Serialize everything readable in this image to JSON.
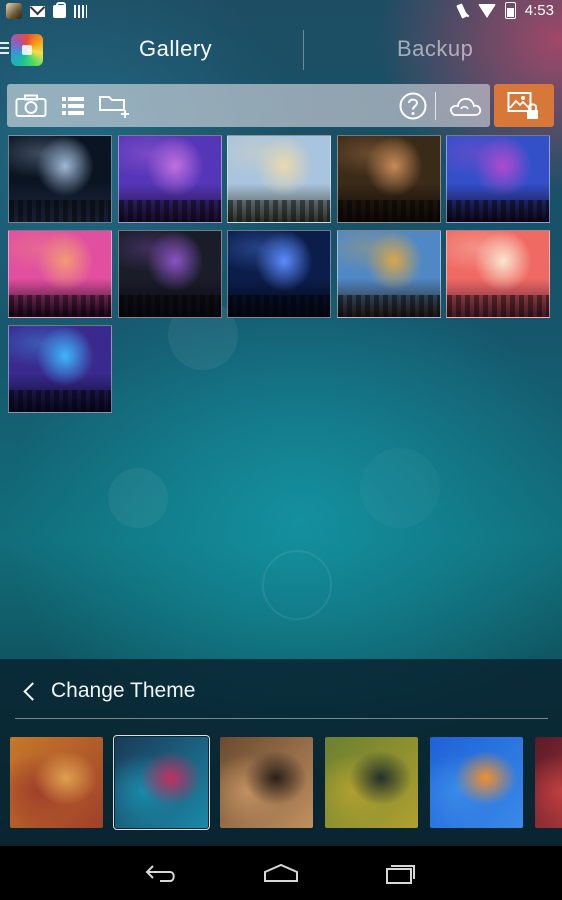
{
  "status_bar": {
    "time": "4:53",
    "left_icons": [
      "app-thumbnail-icon",
      "mail-icon",
      "shopping-bag-icon",
      "barcode-icon"
    ],
    "right_icons": [
      "vibrate-off-icon",
      "wifi-icon",
      "battery-icon"
    ]
  },
  "header": {
    "tabs": [
      {
        "label": "Gallery",
        "active": true
      },
      {
        "label": "Backup",
        "active": false
      }
    ]
  },
  "toolbar": {
    "left_buttons": [
      "camera-icon",
      "list-view-icon",
      "new-folder-icon"
    ],
    "right_buttons": [
      "help-icon",
      "cloud-sync-icon"
    ],
    "lock_button": "private-gallery-lock-icon",
    "lock_color": "#d7773a"
  },
  "gallery": {
    "photos": [
      {
        "label": "concert photo 1",
        "colors": [
          "#0b1422",
          "#9fb9d6",
          "#1e2a44"
        ]
      },
      {
        "label": "concert photo 2",
        "colors": [
          "#5636b8",
          "#c070e0",
          "#1b1030"
        ]
      },
      {
        "label": "concert photo 3",
        "colors": [
          "#a9c4de",
          "#e8d9b0",
          "#3b4030"
        ]
      },
      {
        "label": "concert photo 4",
        "colors": [
          "#3a2a18",
          "#c78b57",
          "#120a06"
        ]
      },
      {
        "label": "concert photo 5",
        "colors": [
          "#3450c9",
          "#b04ad0",
          "#120822"
        ]
      },
      {
        "label": "concert photo 6",
        "colors": [
          "#e14f9f",
          "#f39a78",
          "#1e0820"
        ]
      },
      {
        "label": "concert photo 7",
        "colors": [
          "#1a1c28",
          "#8a54c4",
          "#0a0812"
        ]
      },
      {
        "label": "concert photo 8",
        "colors": [
          "#0b1d4a",
          "#5c8cff",
          "#050814"
        ]
      },
      {
        "label": "concert photo 9",
        "colors": [
          "#4f88c4",
          "#d8a64c",
          "#2a1a12"
        ]
      },
      {
        "label": "concert photo 10",
        "colors": [
          "#f06a64",
          "#fbe5d0",
          "#5a2038"
        ]
      },
      {
        "label": "concert photo 11",
        "colors": [
          "#3a2a8e",
          "#3fb6ff",
          "#0a0a24"
        ]
      }
    ]
  },
  "theme_panel": {
    "title": "Change Theme",
    "back_icon": "chevron-left-icon",
    "themes": [
      {
        "name": "warm orange blur",
        "colors": [
          "#c5782a",
          "#a0402a",
          "#e0a050"
        ],
        "selected": false
      },
      {
        "name": "teal magenta blur",
        "colors": [
          "#1a3a58",
          "#1a8aa8",
          "#c03060"
        ],
        "selected": true
      },
      {
        "name": "brown bokeh blur",
        "colors": [
          "#6a4a30",
          "#c09060",
          "#2a2018"
        ],
        "selected": false
      },
      {
        "name": "green olive blur",
        "colors": [
          "#6a8030",
          "#b0a030",
          "#24302a"
        ],
        "selected": false
      },
      {
        "name": "blue orange blur",
        "colors": [
          "#1e62d8",
          "#3a8ae8",
          "#f09030"
        ],
        "selected": false
      },
      {
        "name": "dark red blur",
        "colors": [
          "#5a1a28",
          "#c04040",
          "#2a2030"
        ],
        "selected": false
      }
    ]
  },
  "nav_bar": {
    "buttons": [
      "back-icon",
      "home-icon",
      "recents-icon"
    ]
  }
}
